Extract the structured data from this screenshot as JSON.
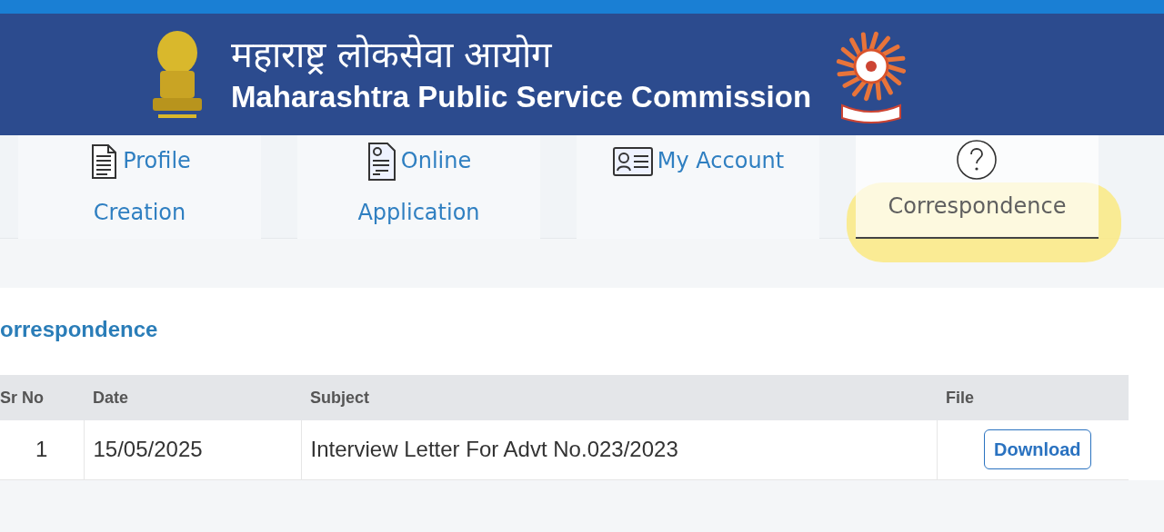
{
  "header": {
    "title_marathi": "महाराष्ट्र लोकसेवा आयोग",
    "title_english": "Maharashtra Public Service Commission"
  },
  "tabs": [
    {
      "kind": "profile",
      "label": "Profile Creation",
      "selected": false
    },
    {
      "kind": "application",
      "label": "Online Application",
      "selected": false
    },
    {
      "kind": "account",
      "label": "My Account",
      "selected": false
    },
    {
      "kind": "help",
      "label": "Correspondence",
      "selected": true,
      "highlighted": true
    }
  ],
  "section": {
    "heading": "orrespondence"
  },
  "table": {
    "columns": [
      "Sr No",
      "Date",
      "Subject",
      "File"
    ],
    "rows": [
      {
        "sr_no": "1",
        "date": "15/05/2025",
        "subject": "Interview Letter For Advt No.023/2023",
        "file_button": "Download"
      }
    ]
  }
}
